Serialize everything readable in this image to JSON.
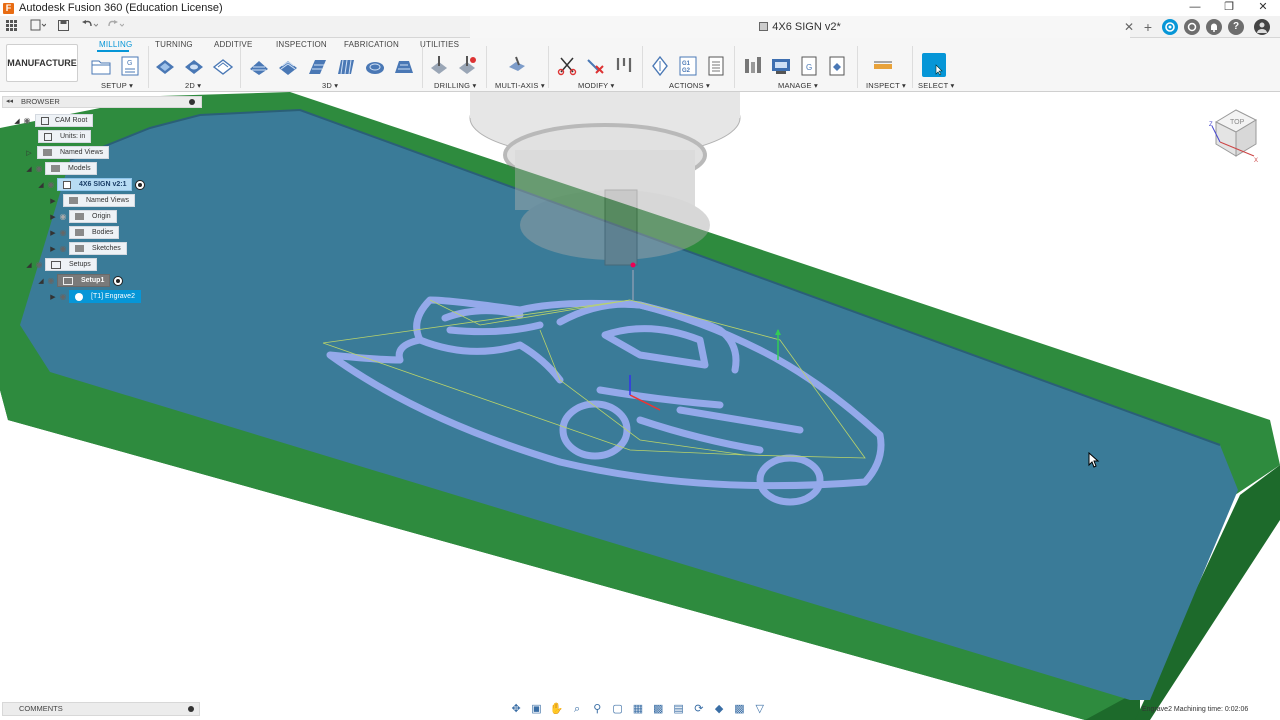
{
  "window": {
    "title": "Autodesk Fusion 360 (Education License)",
    "logo_letter": "F",
    "controls": [
      "—",
      "❐",
      "✕"
    ]
  },
  "tabstrip": {
    "document_title": "4X6 SIGN v2*",
    "close": "✕",
    "new_tab": "+"
  },
  "ribbon": {
    "workspace": "MANUFACTURE",
    "tabs": [
      "MILLING",
      "TURNING",
      "ADDITIVE",
      "INSPECTION",
      "FABRICATION",
      "UTILITIES"
    ],
    "active_tab": "MILLING",
    "groups": [
      "SETUP ▾",
      "2D ▾",
      "3D ▾",
      "DRILLING ▾",
      "MULTI-AXIS ▾",
      "MODIFY ▾",
      "ACTIONS ▾",
      "MANAGE ▾",
      "INSPECT ▾",
      "SELECT ▾"
    ]
  },
  "browser": {
    "header": "BROWSER",
    "collapse": "◂◂",
    "items": [
      {
        "label": "CAM Root"
      },
      {
        "label": "Units: in"
      },
      {
        "label": "Named Views"
      },
      {
        "label": "Models"
      },
      {
        "label": "4X6 SIGN v2:1"
      },
      {
        "label": "Named Views"
      },
      {
        "label": "Origin"
      },
      {
        "label": "Bodies"
      },
      {
        "label": "Sketches"
      },
      {
        "label": "Setups"
      },
      {
        "label": "Setup1"
      },
      {
        "label": "[T1] Engrave2"
      }
    ]
  },
  "viewcube": {
    "face": "TOP"
  },
  "bottom": {
    "comments": "COMMENTS",
    "status_text": "Engrave2 Machining time: 0:02:06"
  },
  "colors": {
    "accent": "#0696d7",
    "stock_green": "#2e8b3e",
    "model_blue": "#3b7c9a",
    "toolpath": "#8fa6e8"
  }
}
